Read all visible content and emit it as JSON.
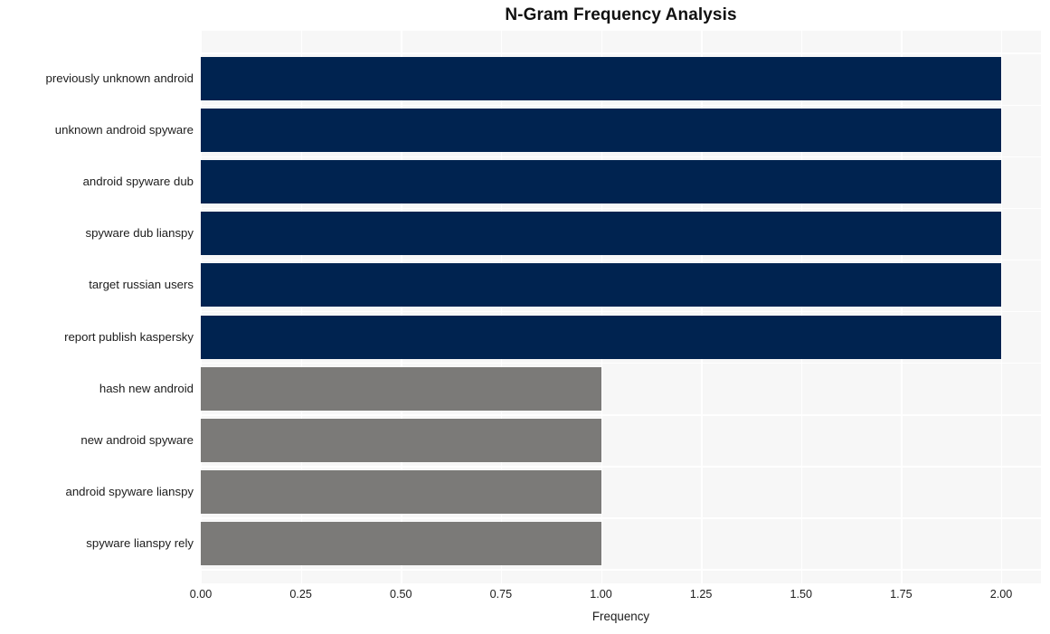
{
  "chart_data": {
    "type": "bar",
    "orientation": "horizontal",
    "title": "N-Gram Frequency Analysis",
    "xlabel": "Frequency",
    "ylabel": "",
    "xlim": [
      0,
      2
    ],
    "ylim": null,
    "grid": true,
    "legend": null,
    "categories": [
      "previously unknown android",
      "unknown android spyware",
      "android spyware dub",
      "spyware dub lianspy",
      "target russian users",
      "report publish kaspersky",
      "hash new android",
      "new android spyware",
      "android spyware lianspy",
      "spyware lianspy rely"
    ],
    "values": [
      2,
      2,
      2,
      2,
      2,
      2,
      1,
      1,
      1,
      1
    ],
    "bar_colors": [
      "#002350",
      "#002350",
      "#002350",
      "#002350",
      "#002350",
      "#002350",
      "#7b7a78",
      "#7b7a78",
      "#7b7a78",
      "#7b7a78"
    ],
    "xticks": [
      "0.00",
      "0.25",
      "0.50",
      "0.75",
      "1.00",
      "1.25",
      "1.50",
      "1.75",
      "2.00"
    ],
    "xtick_values": [
      0,
      0.25,
      0.5,
      0.75,
      1,
      1.25,
      1.5,
      1.75,
      2
    ]
  },
  "style": {
    "plot_background": "#f7f7f7",
    "figure_background": "#ffffff",
    "gridline_color": "#ffffff",
    "text_color": "#1c1c1c",
    "title_color": "#111111",
    "accent_primary": "#002350",
    "accent_secondary": "#7b7a78"
  }
}
